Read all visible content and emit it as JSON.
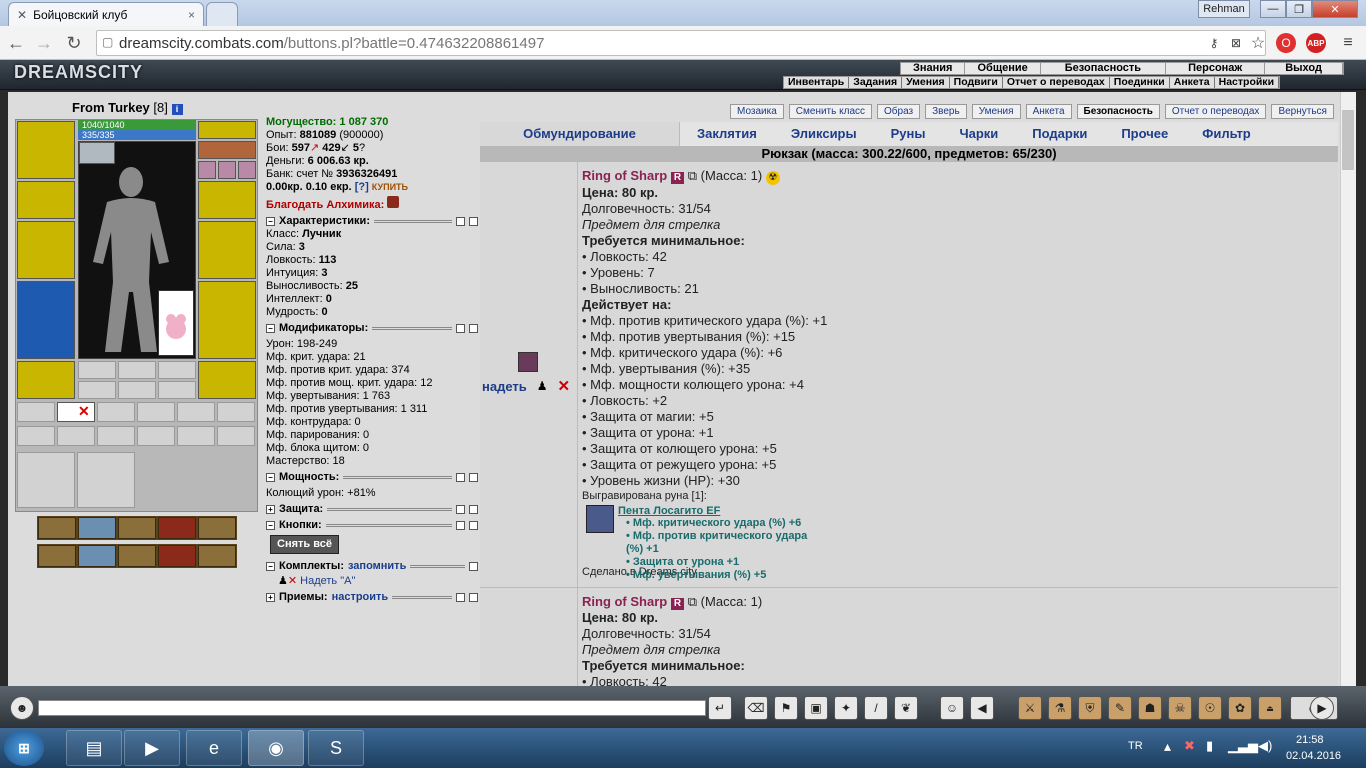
{
  "browser": {
    "tab_title": "Бойцовский клуб",
    "url_host": "dreamscity.combats.com",
    "url_path": "/buttons.pl?battle=0.474632208861497",
    "user": "Rehman",
    "ext_abp": "ABP"
  },
  "game": {
    "logo": "DREAMSCITY",
    "top_menu": [
      "Знания",
      "Общение",
      "Безопасность",
      "Персонаж",
      "Выход"
    ],
    "sub_menu": [
      "Инвентарь",
      "Задания",
      "Умения",
      "Подвиги",
      "Отчет о переводах",
      "Поединки",
      "Анкета",
      "Настройки"
    ]
  },
  "character": {
    "name": "From Turkey",
    "level": "[8]",
    "hp": "1040/1040",
    "mp": "335/335"
  },
  "stats": {
    "power_label": "Могущество:",
    "power": "1 087 370",
    "exp_label": "Опыт:",
    "exp": "881089",
    "exp_next": "(900000)",
    "fights_label": "Бои:",
    "wins": "597",
    "losses": "429",
    "draws": "5",
    "money_label": "Деньги:",
    "money": "6 006.63 кр.",
    "bank_label": "Банк: счет №",
    "bank": "3936326491",
    "ekr_line": "0.00кр. 0.10 екр.",
    "help": "[?]",
    "buy": "КУПИТЬ",
    "bless": "Благодать Алхимика:",
    "sec_chars": "Характеристики:",
    "class_label": "Класс:",
    "class": "Лучник",
    "str_label": "Сила:",
    "str": "3",
    "dex_label": "Ловкость:",
    "dex": "113",
    "int_label": "Интуиция:",
    "int": "3",
    "end_label": "Выносливость:",
    "end": "25",
    "intel_label": "Интеллект:",
    "intel": "0",
    "wis_label": "Мудрость:",
    "wis": "0",
    "sec_mods": "Модификаторы:",
    "mods": [
      "Урон: 198-249",
      "Мф. крит. удара: 21",
      "Мф. против крит. удара: 374",
      "Мф. против мощ. крит. удара: 12",
      "Мф. увертывания: 1 763",
      "Мф. против увертывания: 1 311",
      "Мф. контрудара: 0",
      "Мф. парирования: 0",
      "Мф. блока щитом: 0",
      "Мастерство: 18"
    ],
    "sec_power": "Мощность:",
    "pierce": "Колющий урон: +81%",
    "sec_defense": "Защита:",
    "sec_buttons": "Кнопки:",
    "take_off_all": "Снять всё",
    "sec_sets": "Комплекты:",
    "remember": "запомнить",
    "wear_a": "Надеть \"А\"",
    "sec_tricks": "Приемы:",
    "setup": "настроить"
  },
  "subnav": [
    "Мозаика",
    "Сменить класс",
    "Образ",
    "Зверь",
    "Умения",
    "Анкета",
    "Безопасность",
    "Отчет о переводах",
    "Вернуться"
  ],
  "tabs": [
    "Обмундирование",
    "Заклятия",
    "Эликсиры",
    "Руны",
    "Чарки",
    "Подарки",
    "Прочее",
    "Фильтр"
  ],
  "backpack": "Рюкзак (масса: 300.22/600, предметов: 65/230)",
  "item1": {
    "wear": "надеть",
    "name": "Ring of Sharp",
    "badge": "R",
    "mass": "(Масса: 1)",
    "price": "Цена: 80 кр.",
    "durability": "Долговечность: 31/54",
    "for": "Предмет для стрелка",
    "req_title": "Требуется минимальное:",
    "reqs": [
      "• Ловкость: 42",
      "• Уровень: 7",
      "• Выносливость: 21"
    ],
    "acts_title": "Действует на:",
    "acts": [
      "• Мф. против критического удара (%): +1",
      "• Мф. против увертывания (%): +15",
      "• Мф. критического удара (%): +6",
      "• Мф. увертывания (%): +35",
      "• Мф. мощности колющего урона: +4",
      "• Ловкость: +2",
      "• Защита от магии: +5",
      "• Защита от урона: +1",
      "• Защита от колющего урона: +5",
      "• Защита от режущего урона: +5",
      "• Уровень жизни (HP): +30"
    ],
    "rune_note": "Выгравирована руна [1]:",
    "rune_name": "Пента Лосагито EF",
    "rune_acts": [
      "• Мф. критического удара (%) +6",
      "• Мф. против критического удара (%) +1",
      "• Защита от урона +1",
      "• Мф. увертывания (%) +5"
    ],
    "made_in": "Сделано в Dreams city"
  },
  "item2": {
    "name": "Ring of Sharp",
    "badge": "R",
    "mass": "(Масса: 1)",
    "price": "Цена: 80 кр.",
    "durability": "Долговечность: 31/54",
    "for": "Предмет для стрелка",
    "req_title": "Требуется минимальное:",
    "req1": "• Ловкость: 42"
  },
  "taskbar": {
    "lang": "TR",
    "time": "21:58",
    "date": "02.04.2016"
  },
  "colors": {
    "item_name": "#8b2252",
    "power_green": "#006b00",
    "tab_blue": "#1d3c8a",
    "rune_teal": "#1a6b6b"
  }
}
